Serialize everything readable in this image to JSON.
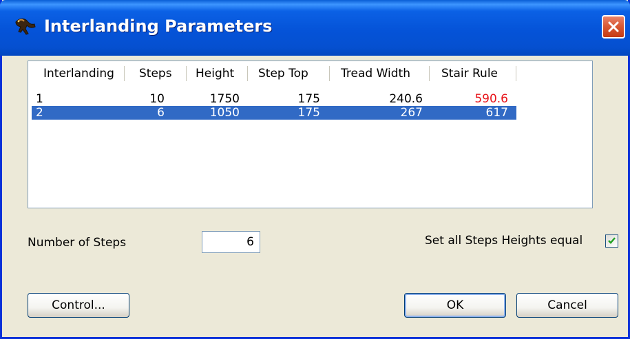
{
  "window": {
    "title": "Interlanding Parameters",
    "app_icon": "lizard-icon",
    "close_icon": "close-icon"
  },
  "table": {
    "columns": [
      "Interlanding",
      "Steps",
      "Height",
      "Step Top",
      "Tread Width",
      "Stair Rule"
    ],
    "rows": [
      {
        "interlanding": "1",
        "steps": "10",
        "height": "1750",
        "step_top": "175",
        "tread_width": "240.6",
        "stair_rule": "590.6",
        "stair_rule_color": "#e8141a",
        "selected": false
      },
      {
        "interlanding": "2",
        "steps": "6",
        "height": "1050",
        "step_top": "175",
        "tread_width": "267",
        "stair_rule": "617",
        "selected": true
      }
    ]
  },
  "form": {
    "number_of_steps_label": "Number of Steps",
    "number_of_steps_value": "6",
    "equal_heights_label": "Set all Steps Heights equal",
    "equal_heights_checked": true
  },
  "buttons": {
    "control": "Control...",
    "ok": "OK",
    "cancel": "Cancel"
  },
  "colors": {
    "selection": "#316ac5",
    "titlebar": "#0553d8",
    "warning_value": "#e8141a"
  }
}
